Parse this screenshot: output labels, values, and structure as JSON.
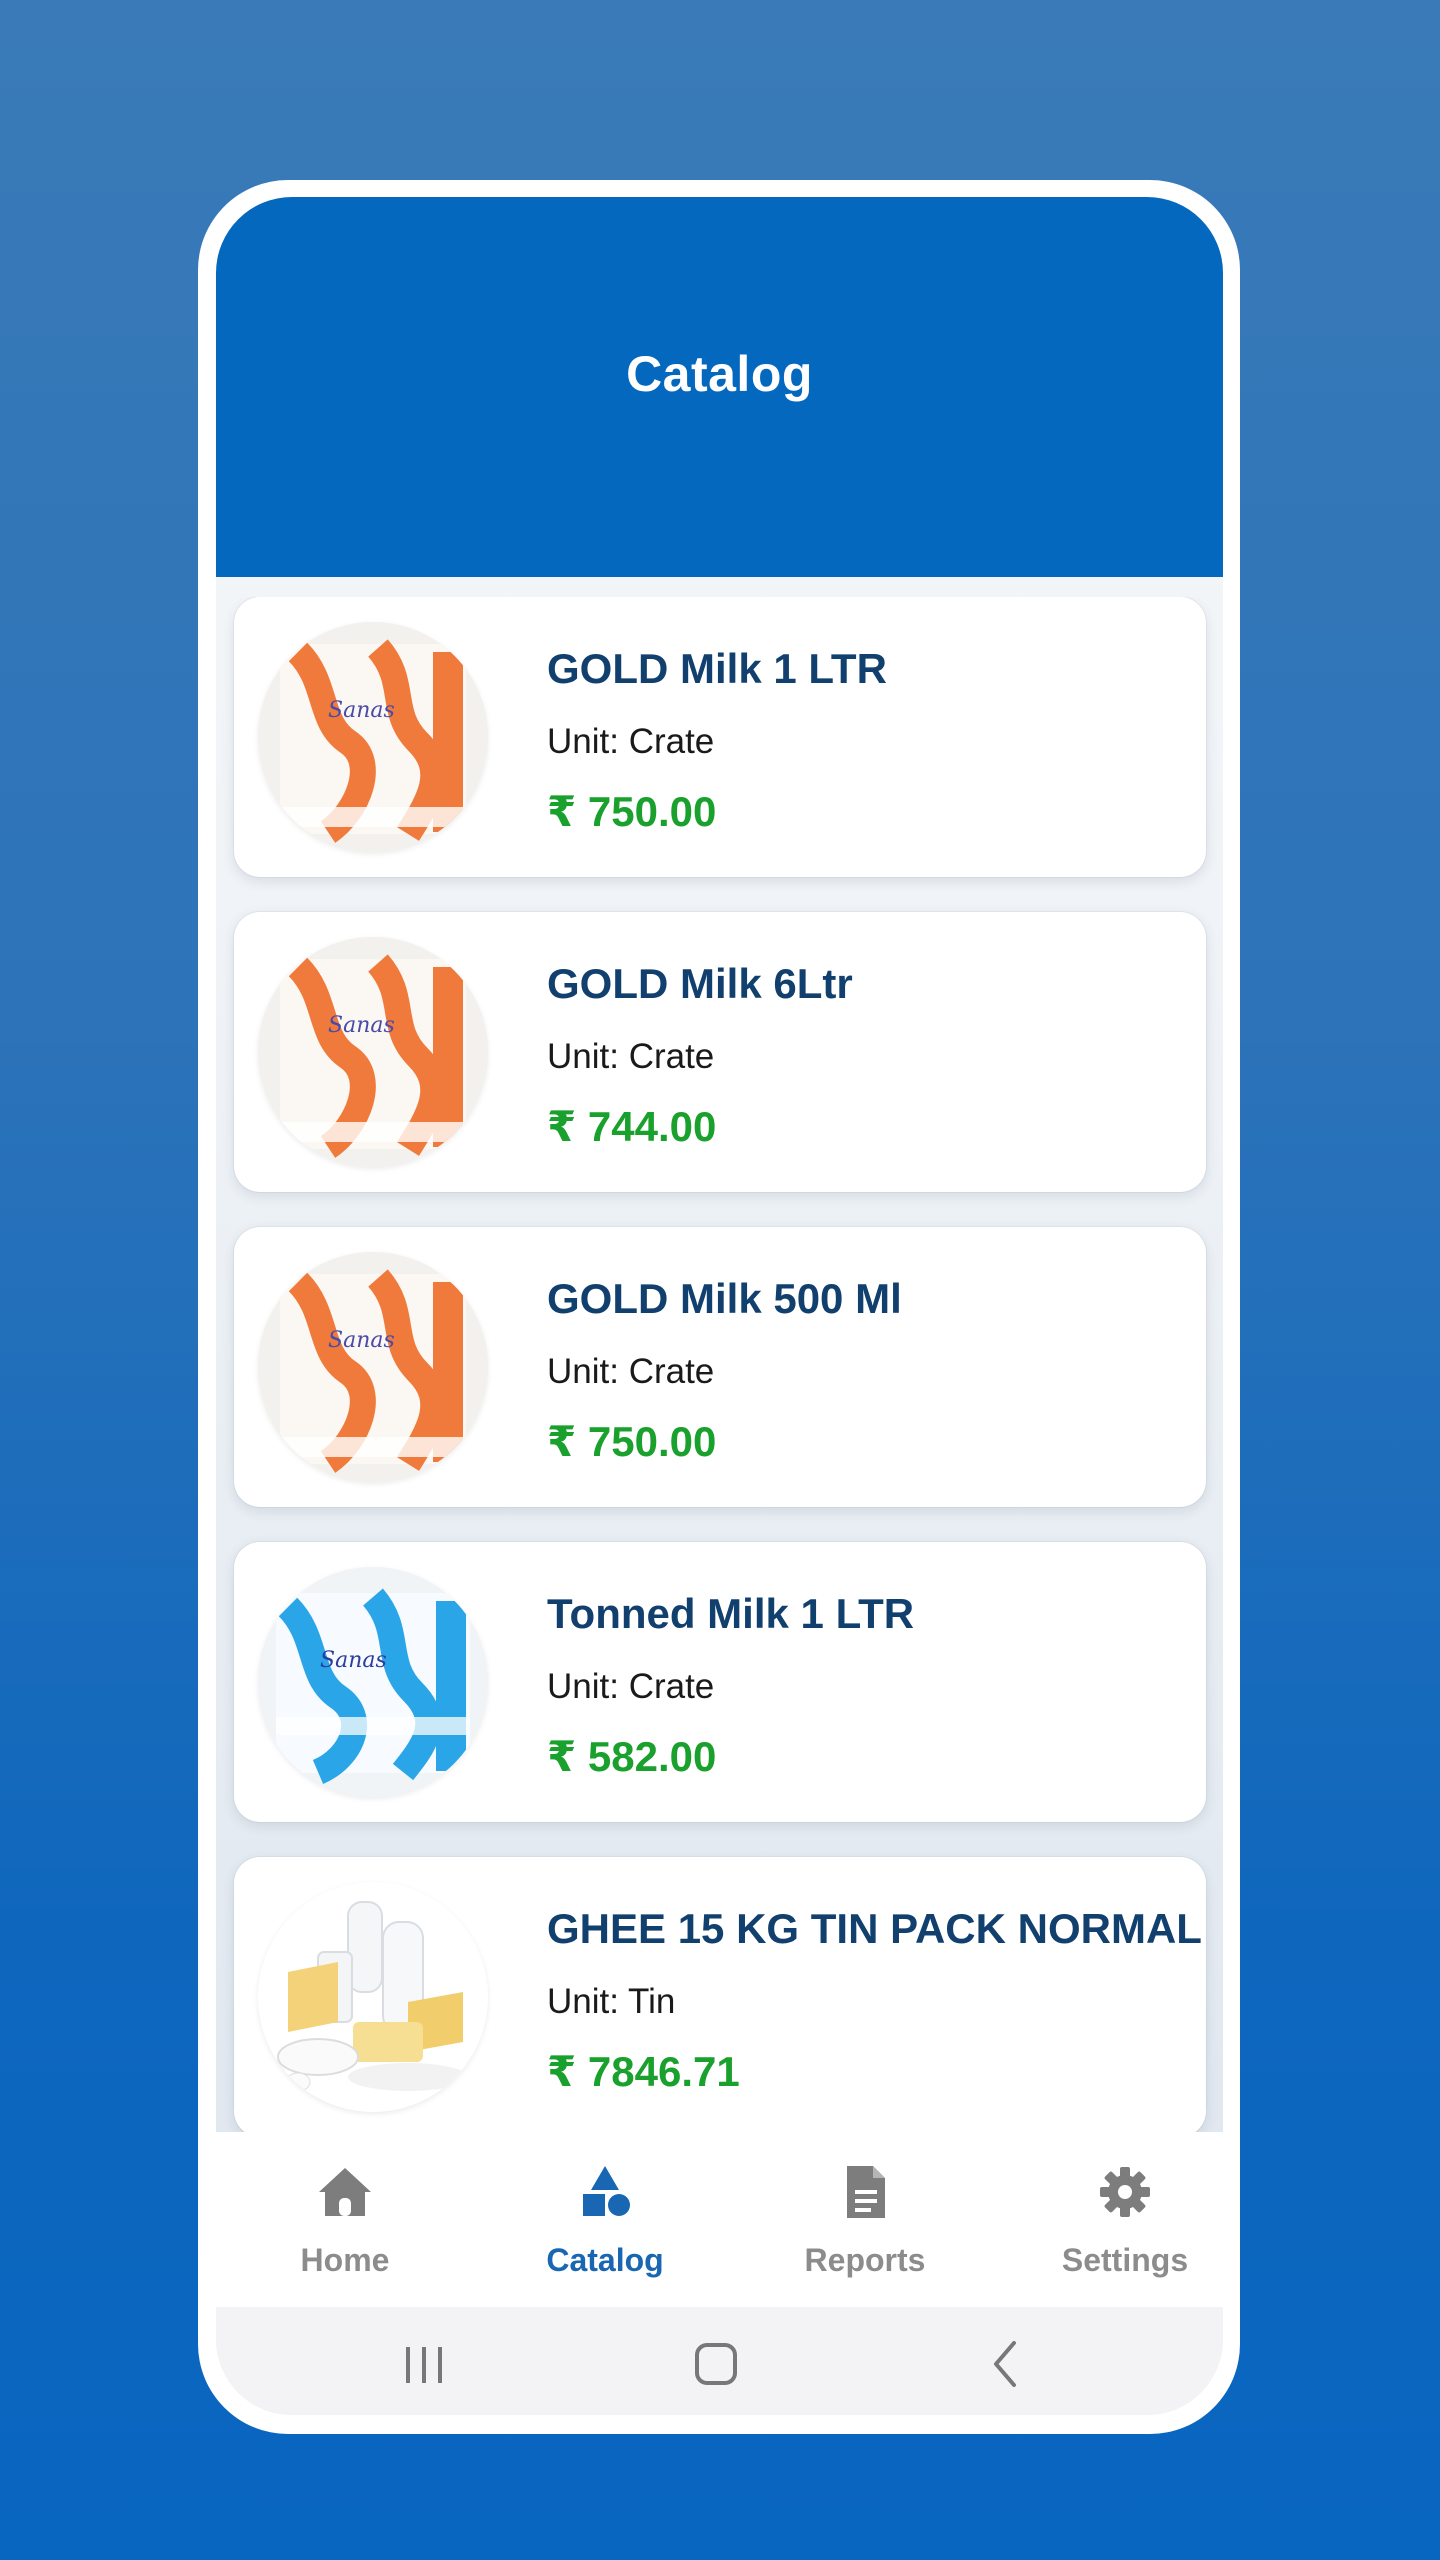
{
  "header": {
    "title": "Catalog"
  },
  "products": [
    {
      "name": "GOLD Milk 1 LTR",
      "unit": "Unit: Crate",
      "price": "₹ 750.00",
      "image": "orange-milk-crate"
    },
    {
      "name": "GOLD Milk 6Ltr",
      "unit": "Unit: Crate",
      "price": "₹ 744.00",
      "image": "orange-milk-crate"
    },
    {
      "name": "GOLD Milk 500 Ml",
      "unit": "Unit: Crate",
      "price": "₹ 750.00",
      "image": "orange-milk-crate"
    },
    {
      "name": "Tonned Milk 1 LTR",
      "unit": "Unit: Crate",
      "price": "₹ 582.00",
      "image": "blue-milk-crate"
    },
    {
      "name": "GHEE 15 KG TIN PACK NORMAL",
      "unit": "Unit: Tin",
      "price": "₹ 7846.71",
      "image": "dairy-products"
    }
  ],
  "tabs": [
    {
      "label": "Home",
      "icon": "home-icon",
      "active": false
    },
    {
      "label": "Catalog",
      "icon": "shapes-icon",
      "active": true
    },
    {
      "label": "Reports",
      "icon": "document-icon",
      "active": false
    },
    {
      "label": "Settings",
      "icon": "gear-icon",
      "active": false
    }
  ],
  "system_nav": {
    "icons": [
      "recents-icon",
      "home-button-icon",
      "back-icon"
    ]
  },
  "colors": {
    "header": "#0468bf",
    "product_name": "#12406e",
    "price": "#1aa02c",
    "active_tab": "#1966b3",
    "inactive_tab": "#8c8c8c"
  }
}
